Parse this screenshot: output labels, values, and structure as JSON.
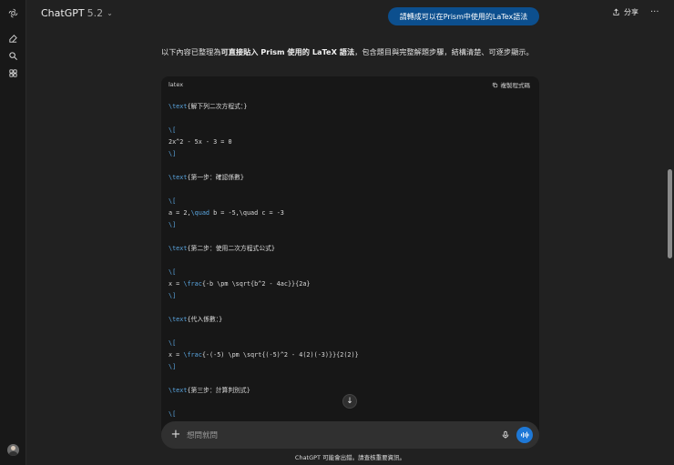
{
  "header": {
    "model_name": "ChatGPT",
    "model_version": "5.2",
    "share_label": "分享",
    "more_label": "···"
  },
  "sidebar": {
    "icons": [
      "openai-logo-icon",
      "new-chat-icon",
      "search-icon",
      "library-icon"
    ]
  },
  "user_message": "請轉成可以在Prism中使用的LaTex語法",
  "assistant": {
    "intro_part1": "以下內容已整理為",
    "intro_bold": "可直接貼入 Prism 使用的 LaTeX 語法",
    "intro_part2": "，包含題目與完整解題步驟，結構清楚、可逐步顯示。",
    "code_language": "latex",
    "copy_label": "複製程式碼",
    "code_lines": [
      {
        "pre": "",
        "kw": "\\text",
        "post": "{解下列二次方程式：}"
      },
      {
        "pre": "",
        "kw": "",
        "post": ""
      },
      {
        "pre": "",
        "kw": "\\[",
        "post": ""
      },
      {
        "pre": "2x^2 - 5x - 3 = 0",
        "kw": "",
        "post": ""
      },
      {
        "pre": "",
        "kw": "\\]",
        "post": ""
      },
      {
        "pre": "",
        "kw": "",
        "post": ""
      },
      {
        "pre": "",
        "kw": "\\text",
        "post": "{第一步：確認係數}"
      },
      {
        "pre": "",
        "kw": "",
        "post": ""
      },
      {
        "pre": "",
        "kw": "\\[",
        "post": ""
      },
      {
        "pre": "a = 2,",
        "kw": "\\quad",
        "post": " b = -5,\\quad c = -3"
      },
      {
        "pre": "",
        "kw": "\\]",
        "post": ""
      },
      {
        "pre": "",
        "kw": "",
        "post": ""
      },
      {
        "pre": "",
        "kw": "\\text",
        "post": "{第二步：使用二次方程式公式}"
      },
      {
        "pre": "",
        "kw": "",
        "post": ""
      },
      {
        "pre": "",
        "kw": "\\[",
        "post": ""
      },
      {
        "pre": "x = ",
        "kw": "\\frac",
        "post": "{-b \\pm \\sqrt{b^2 - 4ac}}{2a}"
      },
      {
        "pre": "",
        "kw": "\\]",
        "post": ""
      },
      {
        "pre": "",
        "kw": "",
        "post": ""
      },
      {
        "pre": "",
        "kw": "\\text",
        "post": "{代入係數：}"
      },
      {
        "pre": "",
        "kw": "",
        "post": ""
      },
      {
        "pre": "",
        "kw": "\\[",
        "post": ""
      },
      {
        "pre": "x = ",
        "kw": "\\frac",
        "post": "{-(-5) \\pm \\sqrt{(-5)^2 - 4(2)(-3)}}{2(2)}"
      },
      {
        "pre": "",
        "kw": "\\]",
        "post": ""
      },
      {
        "pre": "",
        "kw": "",
        "post": ""
      },
      {
        "pre": "",
        "kw": "\\text",
        "post": "{第三步：計算判別式}"
      },
      {
        "pre": "",
        "kw": "",
        "post": ""
      },
      {
        "pre": "",
        "kw": "\\[",
        "post": ""
      }
    ]
  },
  "composer": {
    "placeholder": "想問就問"
  },
  "disclaimer": "ChatGPT 可能會出錯。請查核重要資訊。",
  "colors": {
    "background": "#212121",
    "user_bubble": "#0c4f8e",
    "code_bg": "#171717",
    "keyword": "#5aa6e0",
    "voice_button": "#1e78d6"
  }
}
